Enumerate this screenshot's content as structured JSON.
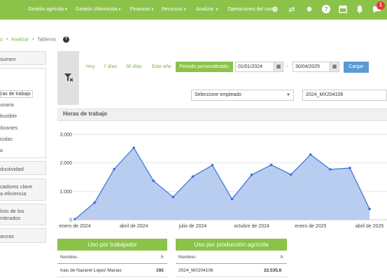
{
  "nav": {
    "menus": [
      "Gestión agrícola",
      "Gestión Vitivinícola",
      "Finanzas",
      "Recursos",
      "Analizar",
      "Operaciones del camp"
    ],
    "notification_count": "1"
  },
  "breadcrumb": {
    "parent_partial": "o",
    "section": "Analizar",
    "current": "Tableros"
  },
  "sidebar": {
    "boxes": [
      "sumen",
      "o",
      "ductividad",
      "cadores clave\na eficiencia",
      "lisis de los\nmbrados",
      "anzas"
    ],
    "subitems": [
      "ras de trabajo",
      "unaria",
      "bustible",
      "ilizantes",
      "icidas",
      "a"
    ]
  },
  "filters": {
    "ranges": [
      "Hoy",
      "7 días",
      "30 días",
      "Este año"
    ],
    "custom_period_label": "Periodo personalizado:",
    "date_from": "01/01/2024",
    "date_to": "30/04/2025",
    "load_button": "Cargar",
    "employee_placeholder": "Seleccione empleado",
    "crop_value": "2024_MX204106"
  },
  "chart_card": {
    "title": "Horas de trabajo"
  },
  "chart_data": {
    "type": "area",
    "x": [
      "2024-01",
      "2024-01",
      "2024-02",
      "2024-03",
      "2024-04",
      "2024-05",
      "2024-06",
      "2024-07",
      "2024-08",
      "2024-09",
      "2024-10",
      "2024-11",
      "2024-12",
      "2025-01",
      "2025-02",
      "2025-03",
      "2025-04"
    ],
    "values": [
      20,
      600,
      1780,
      2530,
      1370,
      800,
      1520,
      1920,
      730,
      1580,
      1930,
      1590,
      2290,
      1770,
      1820,
      380
    ],
    "yticks": [
      "0",
      "1.000",
      "2.000",
      "3.000"
    ],
    "ylim": [
      0,
      3000
    ],
    "xtick_labels": [
      "enero de 2024",
      "abril de 2024",
      "julio de 2024",
      "octubre de 2024",
      "enero de 2025",
      "abril de 2025"
    ],
    "color": "#3a6fd8",
    "fill": "#b9cdf1"
  },
  "table_workers": {
    "title": "Uso por trabajador",
    "col_name": "Nombre↓",
    "col_unit": "h",
    "rows": [
      {
        "name": "Irais de Nazaret Lopez Macias",
        "value": "192"
      }
    ]
  },
  "table_crops": {
    "title": "Uso por producción agrícola",
    "col_name": "Nombre↓",
    "col_unit": "h",
    "rows": [
      {
        "name": "2024_MX204106",
        "value": "22.535,6"
      }
    ]
  }
}
